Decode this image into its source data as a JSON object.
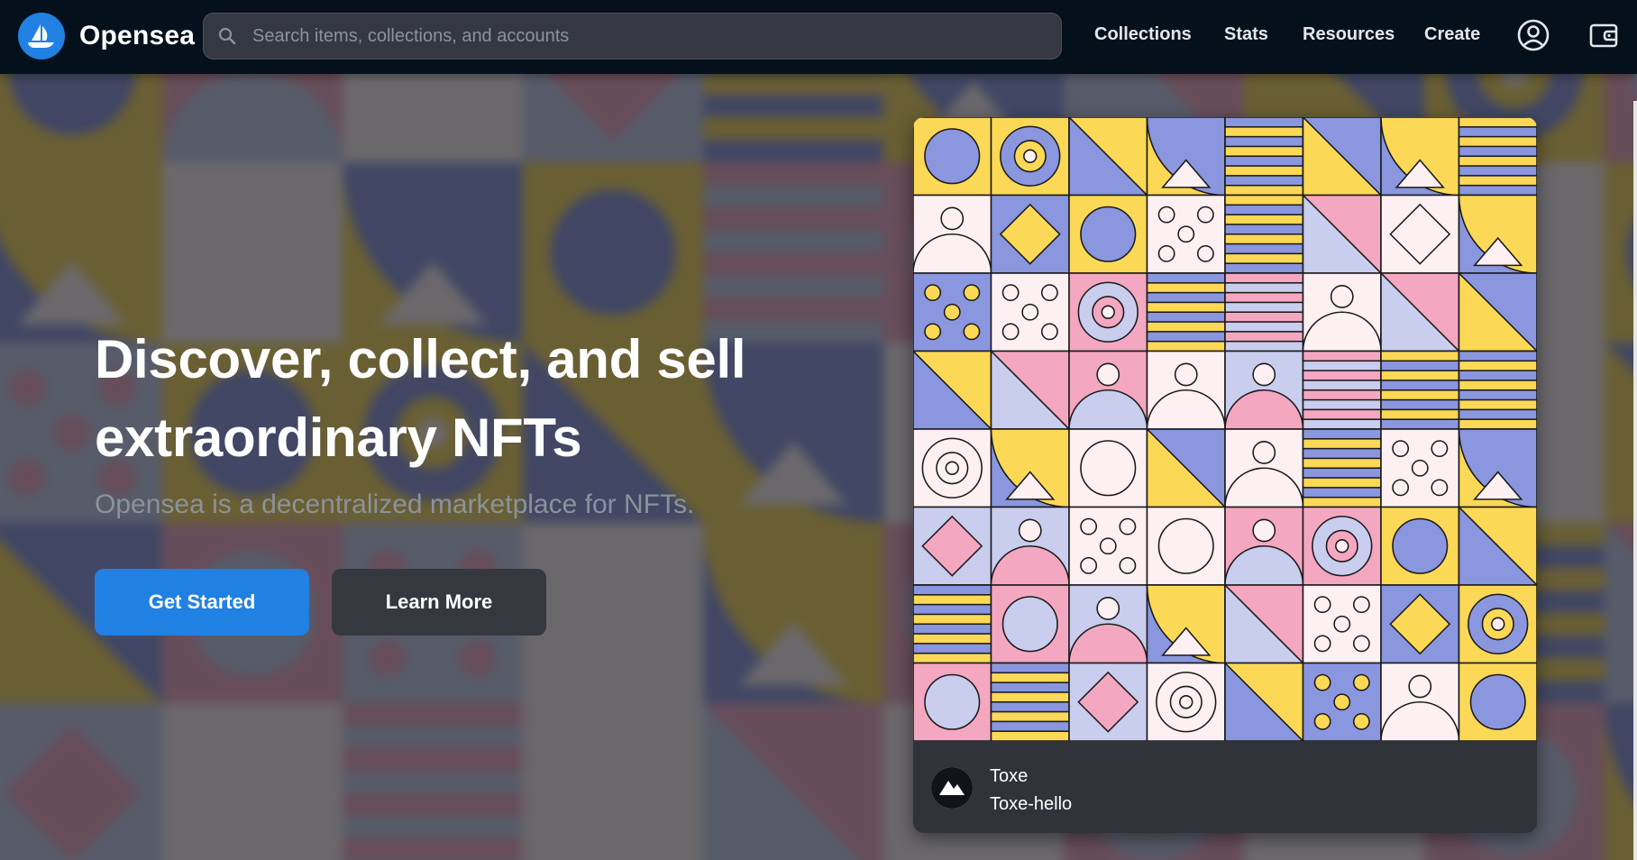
{
  "brand": {
    "name": "Opensea",
    "logo_icon": "opensea-boat-icon",
    "logo_color": "#2081e2"
  },
  "search": {
    "placeholder": "Search items, collections, and accounts",
    "value": "",
    "icon": "search-icon"
  },
  "nav": {
    "links": [
      {
        "label": "Collections"
      },
      {
        "label": "Stats"
      },
      {
        "label": "Resources"
      },
      {
        "label": "Create"
      }
    ],
    "account_icon": "account-icon",
    "wallet_icon": "wallet-icon"
  },
  "hero": {
    "title": "Discover, collect, and sell extraordinary NFTs",
    "subtitle": "Opensea is a decentralized marketplace for NFTs.",
    "primary_button": "Get Started",
    "secondary_button": "Learn More"
  },
  "featured": {
    "name": "Toxe",
    "creator": "Toxe-hello",
    "avatar_icon": "mountain-icon"
  },
  "colors": {
    "navbar": "#04111d",
    "accent": "#2081e2",
    "card": "#303339",
    "art_pink": "#f4a7c0",
    "art_yellow": "#fcd857",
    "art_blue": "#8a96de",
    "art_lavender": "#c9cdee",
    "art_cream": "#fdf0f2"
  }
}
